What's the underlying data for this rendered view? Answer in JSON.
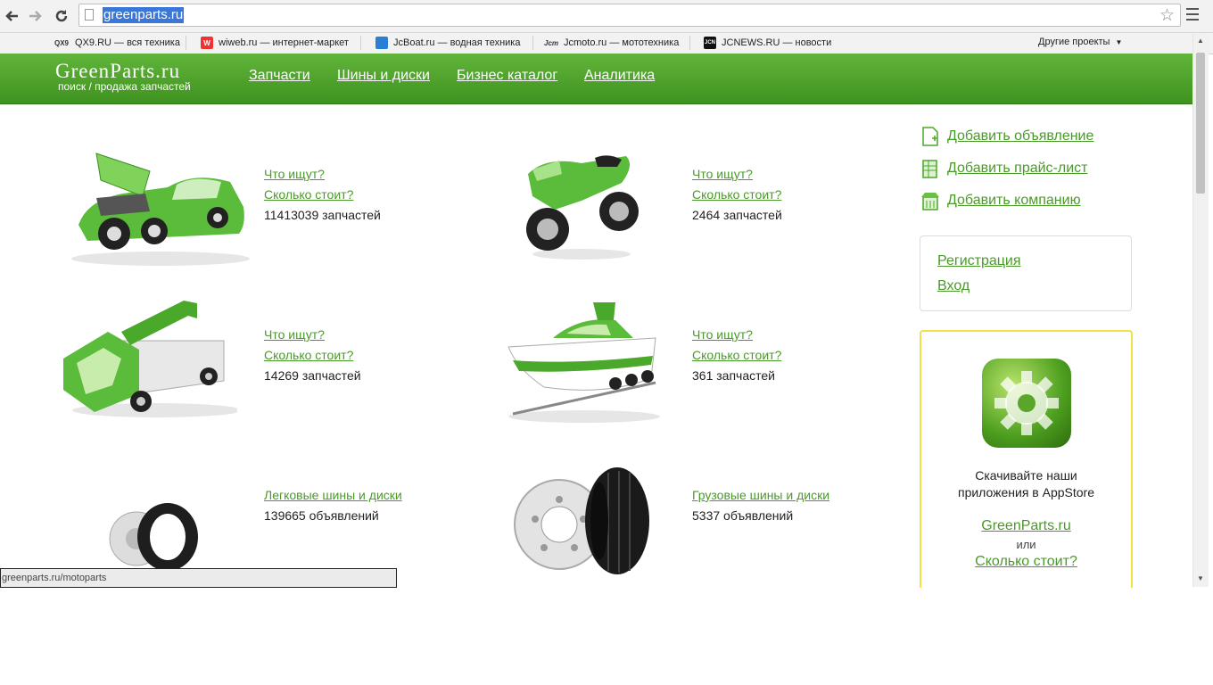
{
  "browser": {
    "url": "greenparts.ru",
    "bookmarks": [
      {
        "icon": "QX9",
        "label": "QX9.RU — вся техника"
      },
      {
        "icon": "W",
        "label": "wiweb.ru — интернет-маркет"
      },
      {
        "icon": "",
        "label": "JcBoat.ru — водная техника"
      },
      {
        "icon": "Jcm",
        "label": "Jcmoto.ru — мототехника"
      },
      {
        "icon": "JCN",
        "label": "JCNEWS.RU — новости"
      }
    ],
    "other_projects": "Другие проекты",
    "status_url": "greenparts.ru/motoparts"
  },
  "header": {
    "logo": "GreenParts.ru",
    "tagline": "поиск / продажа запчастей",
    "nav": [
      "Запчасти",
      "Шины и диски",
      "Бизнес каталог",
      "Аналитика"
    ]
  },
  "categories": [
    {
      "link1": "Что ищут?",
      "link2": "Сколько стоит?",
      "count": "11413039 запчастей"
    },
    {
      "link1": "Что ищут?",
      "link2": "Сколько стоит?",
      "count": "2464 запчастей"
    },
    {
      "link1": "Что ищут?",
      "link2": "Сколько стоит?",
      "count": "14269 запчастей"
    },
    {
      "link1": "Что ищут?",
      "link2": "Сколько стоит?",
      "count": "361 запчастей"
    },
    {
      "link1": "Легковые шины и диски",
      "count": "139665 объявлений"
    },
    {
      "link1": "Грузовые шины и диски",
      "count": "5337 объявлений"
    }
  ],
  "sidebar": {
    "actions": [
      "Добавить объявление",
      "Добавить прайс-лист",
      "Добавить компанию"
    ],
    "register": "Регистрация",
    "login": "Вход",
    "app_text_line1": "Скачивайте наши",
    "app_text_line2": "приложения в AppStore",
    "app_link1": "GreenParts.ru",
    "app_or": "или",
    "app_link2": "Сколько стоит?"
  },
  "colors": {
    "header_green": "#4fa52c",
    "link_green": "#4a9a2a",
    "app_border": "#f0e04a"
  }
}
